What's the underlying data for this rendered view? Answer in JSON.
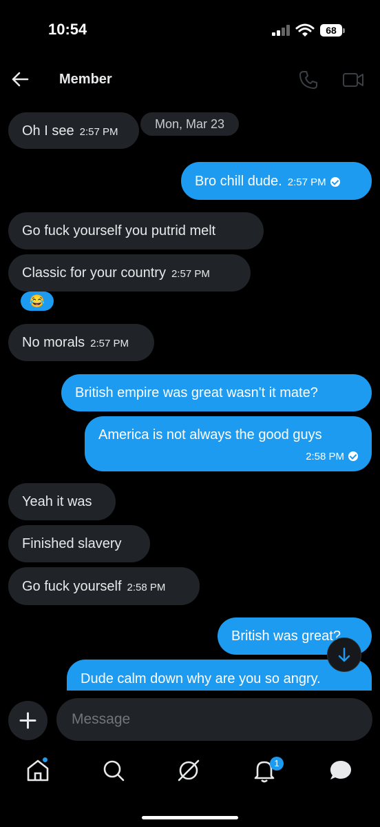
{
  "status_bar": {
    "time": "10:54",
    "battery": "68"
  },
  "header": {
    "title": "Member"
  },
  "date_separator": "Mon, Mar 23",
  "messages": [
    {
      "dir": "in",
      "text": "Oh I see",
      "time": "2:57 PM"
    },
    {
      "dir": "out",
      "text": "Bro chill dude.",
      "time": "2:57 PM"
    },
    {
      "dir": "in",
      "text": "Go fuck yourself you putrid melt",
      "time": ""
    },
    {
      "dir": "in",
      "text": "Classic for your country",
      "time": "2:57 PM"
    },
    {
      "dir": "in",
      "text": "No morals",
      "time": "2:57 PM"
    },
    {
      "dir": "out",
      "text": "British empire was great wasn't it mate?",
      "time": ""
    },
    {
      "dir": "out",
      "text": "America is not always the good guys",
      "time": "2:58 PM"
    },
    {
      "dir": "in",
      "text": "Yeah it was",
      "time": ""
    },
    {
      "dir": "in",
      "text": "Finished slavery",
      "time": ""
    },
    {
      "dir": "in",
      "text": "Go fuck yourself",
      "time": "2:58 PM"
    },
    {
      "dir": "out",
      "text": "British was great?",
      "time": ""
    },
    {
      "dir": "out",
      "text": "Dude calm down why are you so angry.",
      "time": ""
    }
  ],
  "reaction_emoji": "😂",
  "composer": {
    "placeholder": "Message"
  },
  "nav": {
    "notifications_badge": "1"
  },
  "colors": {
    "accent": "#1d9bf0",
    "incoming_bubble": "#202327",
    "background": "#000000"
  },
  "icons": [
    "back-arrow-icon",
    "phone-icon",
    "video-icon",
    "plus-icon",
    "home-icon",
    "search-icon",
    "grok-icon",
    "bell-icon",
    "messages-icon",
    "chevron-down-icon",
    "verified-check-icon"
  ]
}
